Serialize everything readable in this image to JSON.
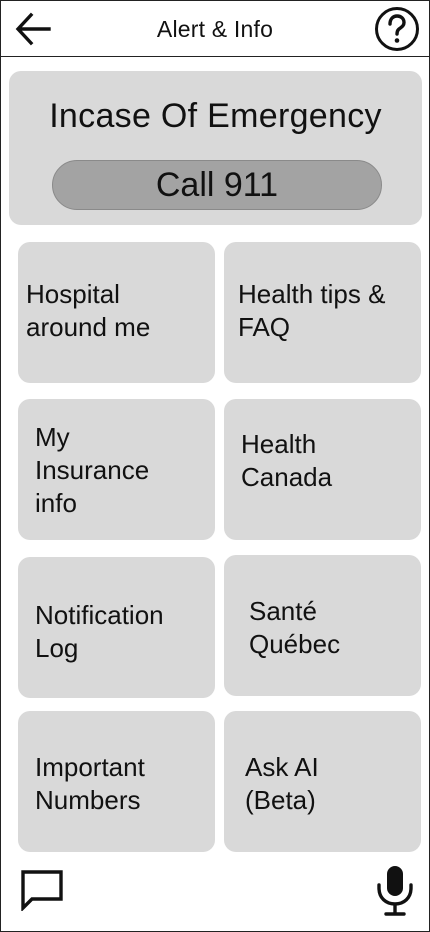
{
  "header": {
    "title": "Alert & Info",
    "back_icon": "arrow-left-icon",
    "help_icon": "question-circle-icon"
  },
  "emergency": {
    "title": "Incase Of Emergency",
    "call_label": "Call 911"
  },
  "tiles": [
    {
      "id": "hospital",
      "label": "Hospital\naround me"
    },
    {
      "id": "health-tips",
      "label": "Health tips &\nFAQ"
    },
    {
      "id": "insurance",
      "label": "My\nInsurance\ninfo"
    },
    {
      "id": "health-canada",
      "label": "Health\nCanada"
    },
    {
      "id": "notification-log",
      "label": "Notification\nLog"
    },
    {
      "id": "sante-quebec",
      "label": "Santé\nQuébec"
    },
    {
      "id": "important-numbers",
      "label": "Important\nNumbers"
    },
    {
      "id": "ask-ai",
      "label": "Ask AI\n(Beta)"
    }
  ],
  "footer": {
    "chat_icon": "chat-bubble-icon",
    "mic_icon": "microphone-icon"
  },
  "colors": {
    "tile_bg": "#d9d9d9",
    "call_button_bg": "#a3a3a3",
    "border": "#222222"
  }
}
